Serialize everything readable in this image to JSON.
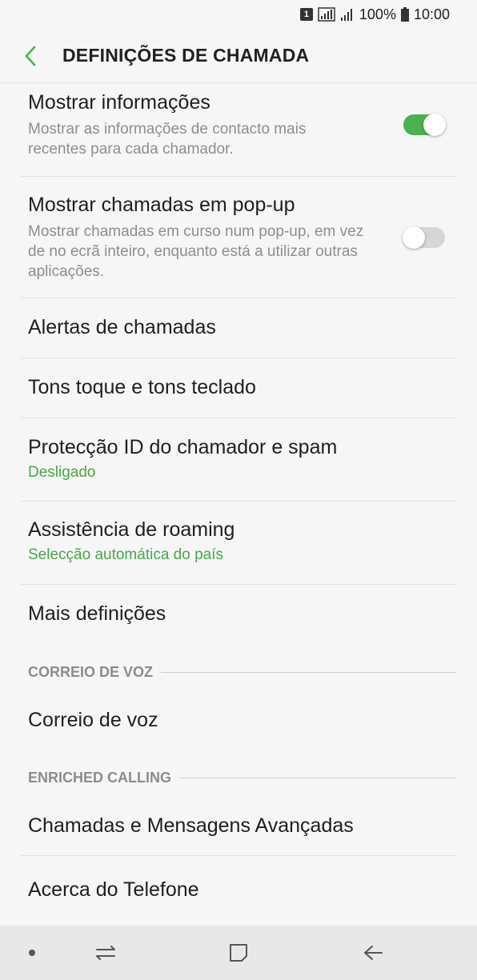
{
  "status": {
    "sim": "1",
    "battery": "100%",
    "time": "10:00"
  },
  "header": {
    "title": "DEFINIÇÕES DE CHAMADA"
  },
  "items": [
    {
      "title": "Mostrar informações",
      "subtitle": "Mostrar as informações de contacto mais recentes para cada chamador.",
      "toggle": true
    },
    {
      "title": "Mostrar chamadas em pop-up",
      "subtitle": "Mostrar chamadas em curso num pop-up, em vez de no ecrã inteiro, enquanto está a utilizar outras aplicações.",
      "toggle": false
    },
    {
      "title": "Alertas de chamadas"
    },
    {
      "title": "Tons toque e tons teclado"
    },
    {
      "title": "Protecção ID do chamador e spam",
      "value": "Desligado"
    },
    {
      "title": "Assistência de roaming",
      "value": "Selecção automática do país"
    },
    {
      "title": "Mais definições"
    }
  ],
  "sections": {
    "voicemail": {
      "label": "CORREIO DE VOZ",
      "item": "Correio de voz"
    },
    "enriched": {
      "label": "ENRICHED CALLING",
      "items": [
        "Chamadas e Mensagens Avançadas",
        "Acerca do Telefone"
      ]
    }
  },
  "colors": {
    "accent": "#4caf50",
    "toggle_off": "#d6d6d6"
  }
}
